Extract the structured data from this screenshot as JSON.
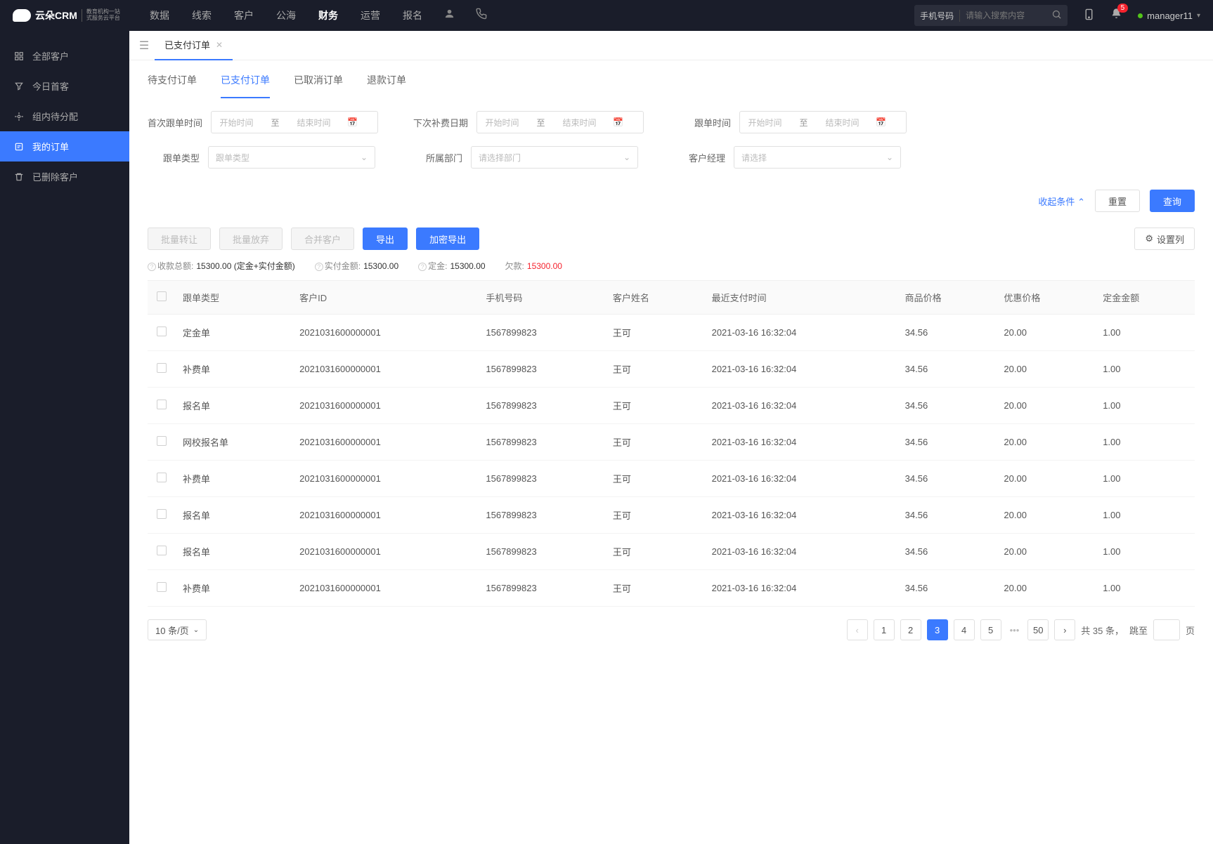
{
  "header": {
    "logo_name": "云朵CRM",
    "logo_sub1": "教育机构一站",
    "logo_sub2": "式服务云平台",
    "nav": [
      "数据",
      "线索",
      "客户",
      "公海",
      "财务",
      "运营",
      "报名"
    ],
    "nav_active": 4,
    "search_type": "手机号码",
    "search_placeholder": "请输入搜索内容",
    "notif_badge": "5",
    "user": "manager11"
  },
  "sidebar": {
    "items": [
      {
        "label": "全部客户"
      },
      {
        "label": "今日首客"
      },
      {
        "label": "组内待分配"
      },
      {
        "label": "我的订单"
      },
      {
        "label": "已删除客户"
      }
    ],
    "active": 3
  },
  "tab": {
    "label": "已支付订单"
  },
  "sub_tabs": {
    "items": [
      "待支付订单",
      "已支付订单",
      "已取消订单",
      "退款订单"
    ],
    "active": 1
  },
  "filters": {
    "first_follow_label": "首次跟单时间",
    "next_renew_label": "下次补费日期",
    "follow_time_label": "跟单时间",
    "follow_type_label": "跟单类型",
    "dept_label": "所属部门",
    "manager_label": "客户经理",
    "start_ph": "开始时间",
    "end_ph": "结束时间",
    "to": "至",
    "follow_type_ph": "跟单类型",
    "dept_ph": "请选择部门",
    "manager_ph": "请选择",
    "collapse": "收起条件",
    "reset": "重置",
    "query": "查询"
  },
  "toolbar": {
    "batch_transfer": "批量转让",
    "batch_abandon": "批量放弃",
    "merge": "合并客户",
    "export": "导出",
    "export_enc": "加密导出",
    "set_cols": "设置列"
  },
  "summary": {
    "total_label": "收款总额:",
    "total_value": "15300.00 (定金+实付金额)",
    "paid_label": "实付金额:",
    "paid_value": "15300.00",
    "deposit_label": "定金:",
    "deposit_value": "15300.00",
    "owed_label": "欠款:",
    "owed_value": "15300.00"
  },
  "table": {
    "headers": [
      "跟单类型",
      "客户ID",
      "手机号码",
      "客户姓名",
      "最近支付时间",
      "商品价格",
      "优惠价格",
      "定金金额"
    ],
    "rows": [
      {
        "type": "定金单",
        "cid": "2021031600000001",
        "phone": "1567899823",
        "name": "王可",
        "ptime": "2021-03-16 16:32:04",
        "price": "34.56",
        "disc": "20.00",
        "dep": "1.00"
      },
      {
        "type": "补费单",
        "cid": "2021031600000001",
        "phone": "1567899823",
        "name": "王可",
        "ptime": "2021-03-16 16:32:04",
        "price": "34.56",
        "disc": "20.00",
        "dep": "1.00"
      },
      {
        "type": "报名单",
        "cid": "2021031600000001",
        "phone": "1567899823",
        "name": "王可",
        "ptime": "2021-03-16 16:32:04",
        "price": "34.56",
        "disc": "20.00",
        "dep": "1.00"
      },
      {
        "type": "网校报名单",
        "cid": "2021031600000001",
        "phone": "1567899823",
        "name": "王可",
        "ptime": "2021-03-16 16:32:04",
        "price": "34.56",
        "disc": "20.00",
        "dep": "1.00"
      },
      {
        "type": "补费单",
        "cid": "2021031600000001",
        "phone": "1567899823",
        "name": "王可",
        "ptime": "2021-03-16 16:32:04",
        "price": "34.56",
        "disc": "20.00",
        "dep": "1.00"
      },
      {
        "type": "报名单",
        "cid": "2021031600000001",
        "phone": "1567899823",
        "name": "王可",
        "ptime": "2021-03-16 16:32:04",
        "price": "34.56",
        "disc": "20.00",
        "dep": "1.00"
      },
      {
        "type": "报名单",
        "cid": "2021031600000001",
        "phone": "1567899823",
        "name": "王可",
        "ptime": "2021-03-16 16:32:04",
        "price": "34.56",
        "disc": "20.00",
        "dep": "1.00"
      },
      {
        "type": "补费单",
        "cid": "2021031600000001",
        "phone": "1567899823",
        "name": "王可",
        "ptime": "2021-03-16 16:32:04",
        "price": "34.56",
        "disc": "20.00",
        "dep": "1.00"
      }
    ]
  },
  "pager": {
    "page_size": "10 条/页",
    "buttons": [
      "1",
      "2",
      "3",
      "4",
      "5"
    ],
    "last": "50",
    "active": 2,
    "total_prefix": "共 ",
    "total_count": "35",
    "total_suffix": " 条，",
    "jump_label": "跳至",
    "page_word": "页"
  }
}
